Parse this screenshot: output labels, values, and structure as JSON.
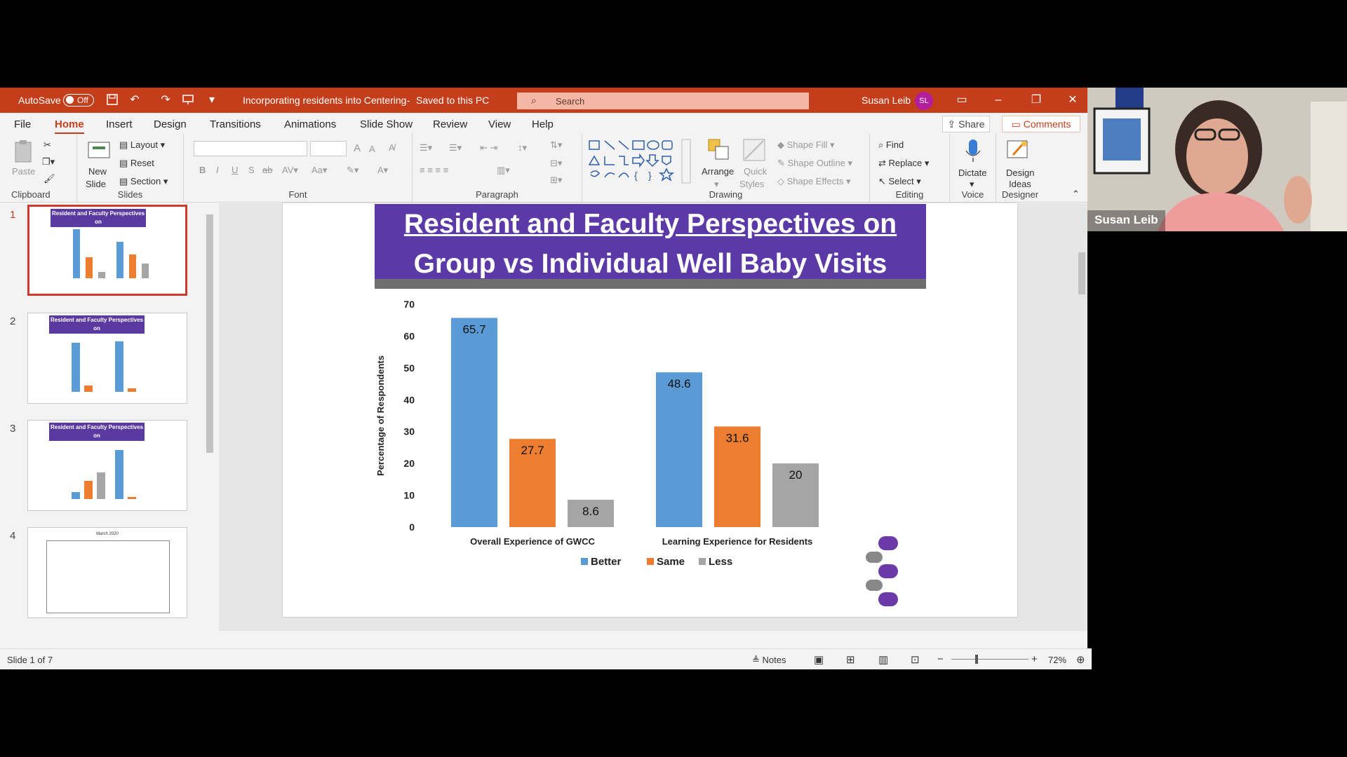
{
  "titlebar": {
    "autosave_label": "AutoSave",
    "autosave_state": "Off",
    "document": "Incorporating residents into Centering",
    "save_status": "Saved to this PC",
    "search_placeholder": "Search",
    "user_name": "Susan Leib",
    "user_initials": "SL"
  },
  "menu": {
    "tabs": [
      "File",
      "Home",
      "Insert",
      "Design",
      "Transitions",
      "Animations",
      "Slide Show",
      "Review",
      "View",
      "Help"
    ],
    "active": "Home",
    "share": "Share",
    "comments": "Comments"
  },
  "ribbon": {
    "clipboard": {
      "label": "Clipboard",
      "paste": "Paste"
    },
    "slides": {
      "label": "Slides",
      "new_slide_1": "New",
      "new_slide_2": "Slide",
      "layout": "Layout",
      "reset": "Reset",
      "section": "Section"
    },
    "font": {
      "label": "Font"
    },
    "paragraph": {
      "label": "Paragraph"
    },
    "drawing": {
      "label": "Drawing",
      "arrange": "Arrange",
      "quick_styles_1": "Quick",
      "quick_styles_2": "Styles",
      "shape_fill": "Shape Fill",
      "shape_outline": "Shape Outline",
      "shape_effects": "Shape Effects"
    },
    "editing": {
      "label": "Editing",
      "find": "Find",
      "replace": "Replace",
      "select": "Select"
    },
    "voice": {
      "label": "Voice",
      "dictate": "Dictate"
    },
    "designer": {
      "label": "Designer",
      "design_ideas_1": "Design",
      "design_ideas_2": "Ideas"
    }
  },
  "thumbnails": {
    "numbers": [
      "1",
      "2",
      "3",
      "4"
    ],
    "title_line1": "Resident and Faculty Perspectives on",
    "title_line2": "Group vs  Individual Well Baby Visits",
    "thumb4_title": "March 2020"
  },
  "slide": {
    "title_line1": "Resident and Faculty Perspectives on",
    "title_line2": "Group vs  Individual Well Baby Visits"
  },
  "chart_data": {
    "type": "bar",
    "categories": [
      "Overall Experience of GWCC",
      "Learning Experience for Residents"
    ],
    "series": [
      {
        "name": "Better",
        "values": [
          65.7,
          48.6
        ],
        "color": "#5b9bd5"
      },
      {
        "name": "Same",
        "values": [
          27.7,
          31.6
        ],
        "color": "#ed7d31"
      },
      {
        "name": "Less",
        "values": [
          8.6,
          20
        ],
        "color": "#a5a5a5"
      }
    ],
    "data_labels": [
      [
        "65.7",
        "48.6"
      ],
      [
        "27.7",
        "31.6"
      ],
      [
        "8.6",
        "20"
      ]
    ],
    "ylabel": "Percentage of Respondents",
    "ylim": [
      0,
      70
    ],
    "yticks": [
      "0",
      "10",
      "20",
      "30",
      "40",
      "50",
      "60",
      "70"
    ],
    "legend_position": "bottom",
    "grid": false
  },
  "status": {
    "slide_info": "Slide 1 of 7",
    "notes": "Notes",
    "zoom": "72%"
  },
  "webcam": {
    "name": "Susan Leib"
  },
  "colors": {
    "accent": "#c43e1c",
    "slide_title_bg": "#5b3aa8"
  }
}
